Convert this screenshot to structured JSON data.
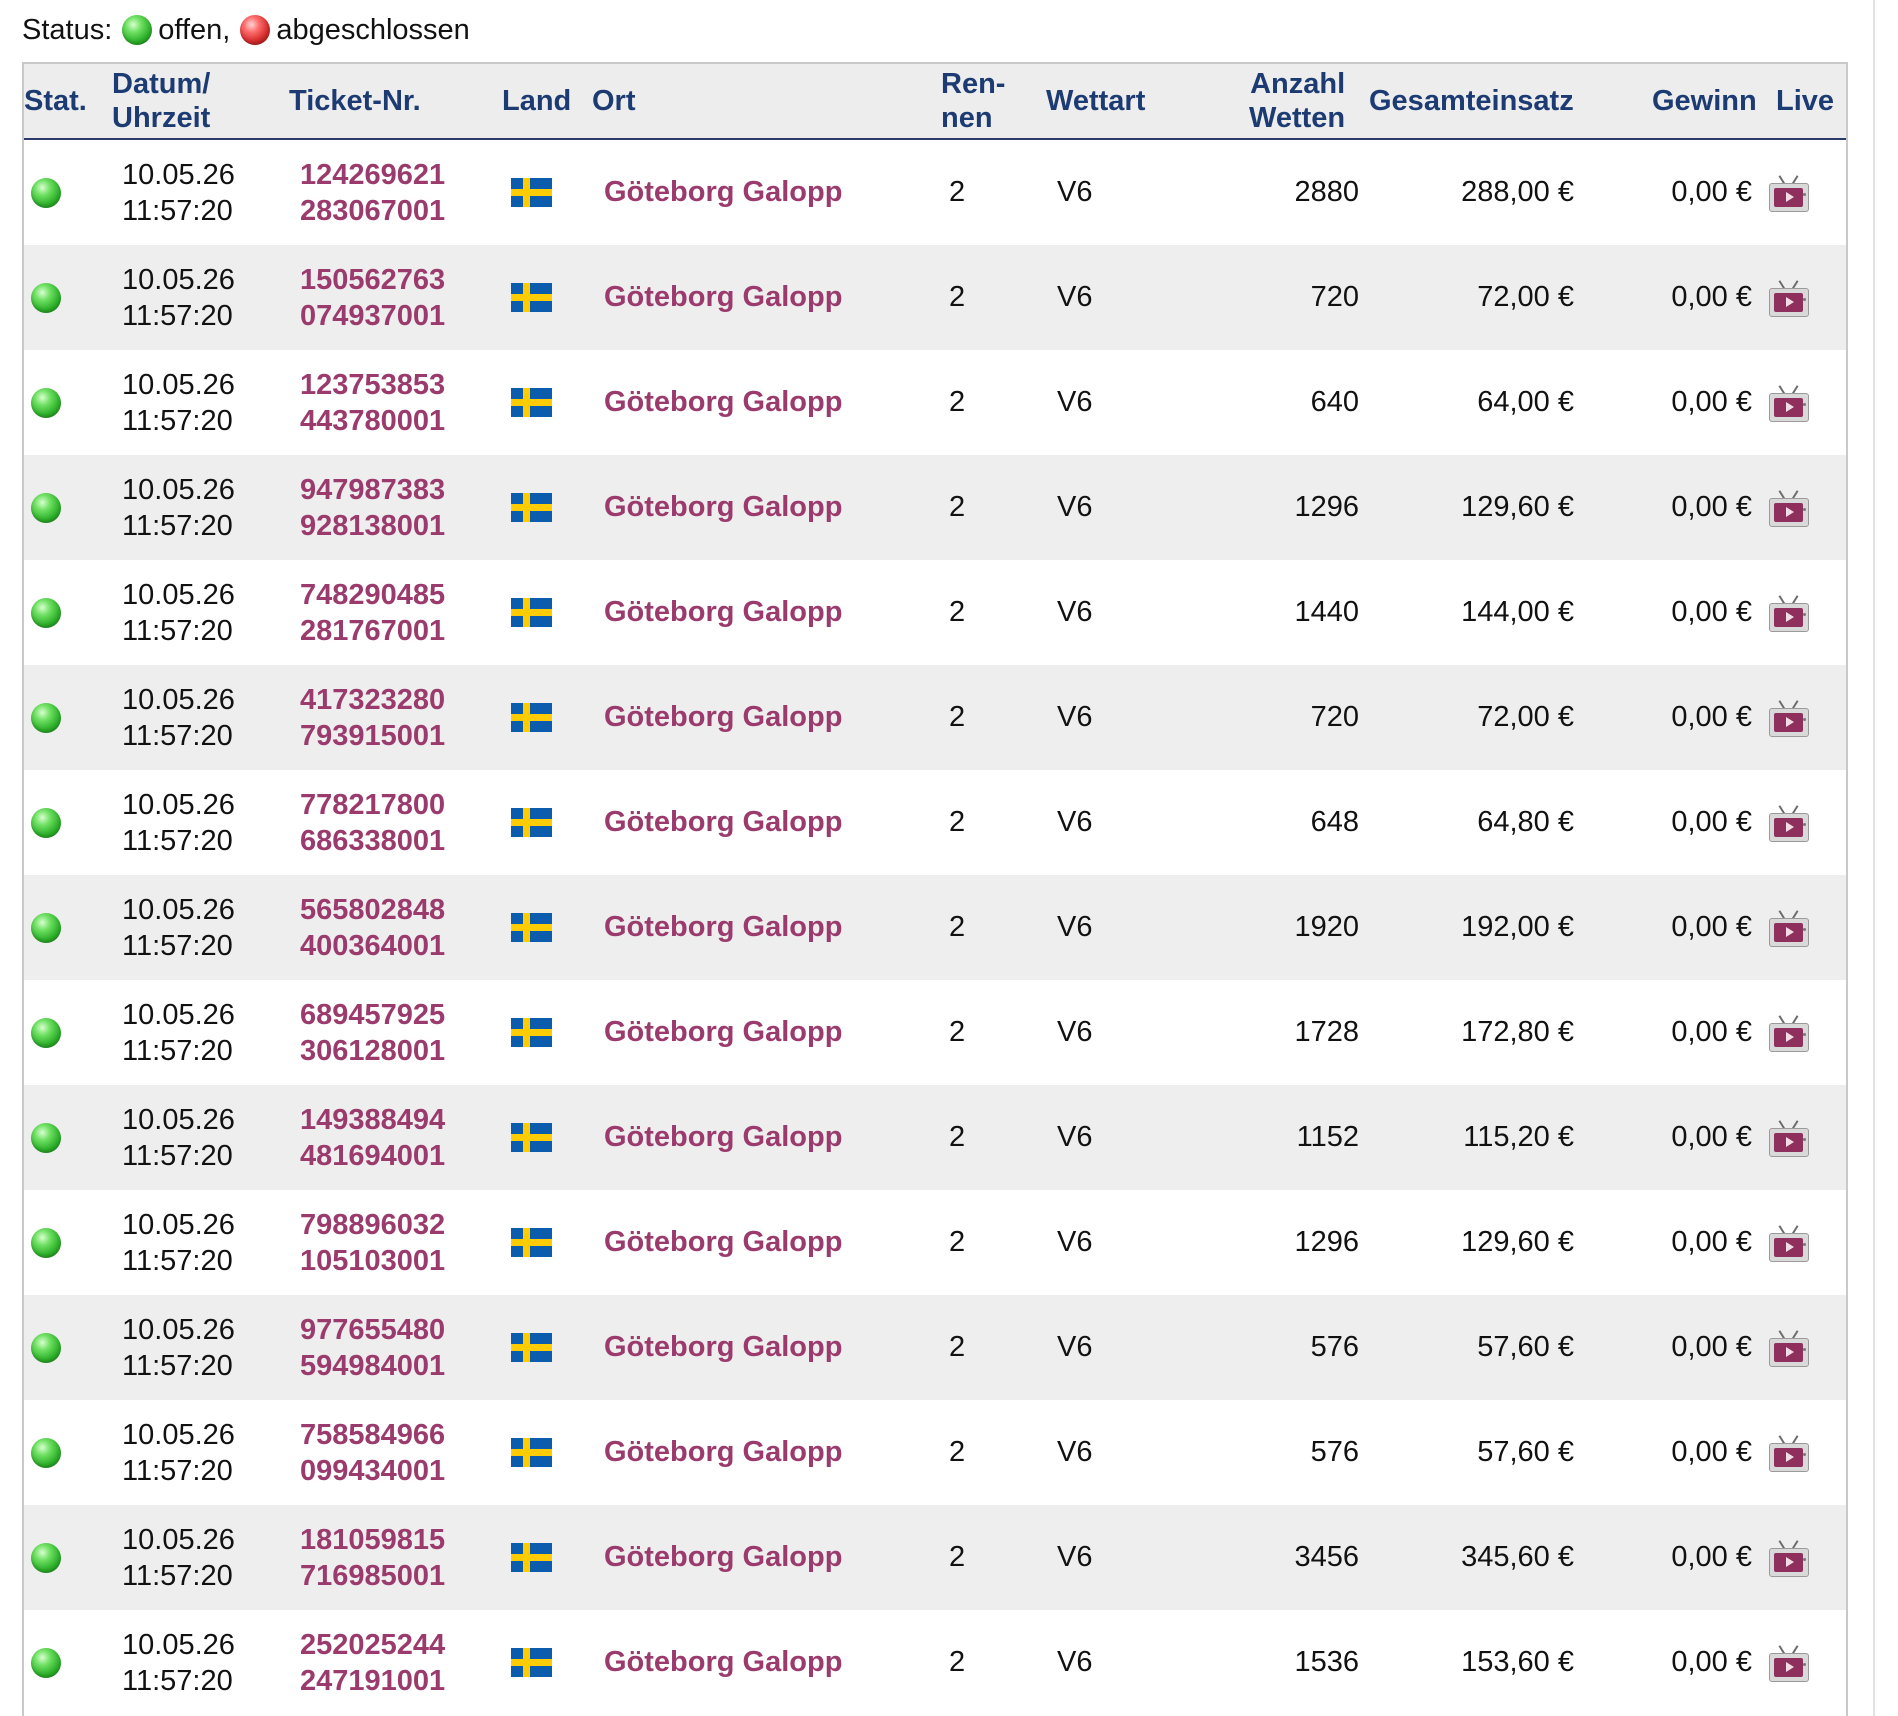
{
  "legend": {
    "label": "Status:",
    "open_label": "offen,",
    "closed_label": "abgeschlossen",
    "open_icon": "green-status-dot",
    "closed_icon": "red-status-dot",
    "open_color": "#2db02a",
    "closed_color": "#d22a2a"
  },
  "table": {
    "headers": {
      "status": "Stat.",
      "datetime_1": "Datum/",
      "datetime_2": "Uhrzeit",
      "ticket": "Ticket-Nr.",
      "country": "Land",
      "place": "Ort",
      "race_1": "Ren-",
      "race_2": "nen",
      "bet_type": "Wettart",
      "count_1": "Anzahl",
      "count_2": "Wetten",
      "stake": "Gesamteinsatz",
      "win": "Gewinn",
      "live": "Live"
    },
    "header_color": "#1d3b73",
    "link_color": "#9b3b6d",
    "row_alt_color": "#eeeeee",
    "rows": [
      {
        "status": "open",
        "date": "10.05.26",
        "time": "11:57:20",
        "ticket_1": "124269621",
        "ticket_2": "283067001",
        "country": "Schweden",
        "place": "Göteborg Galopp",
        "race": "2",
        "bet_type": "V6",
        "bets": "2880",
        "stake": "288,00 €",
        "win": "0,00 €"
      },
      {
        "status": "open",
        "date": "10.05.26",
        "time": "11:57:20",
        "ticket_1": "150562763",
        "ticket_2": "074937001",
        "country": "Schweden",
        "place": "Göteborg Galopp",
        "race": "2",
        "bet_type": "V6",
        "bets": "720",
        "stake": "72,00 €",
        "win": "0,00 €"
      },
      {
        "status": "open",
        "date": "10.05.26",
        "time": "11:57:20",
        "ticket_1": "123753853",
        "ticket_2": "443780001",
        "country": "Schweden",
        "place": "Göteborg Galopp",
        "race": "2",
        "bet_type": "V6",
        "bets": "640",
        "stake": "64,00 €",
        "win": "0,00 €"
      },
      {
        "status": "open",
        "date": "10.05.26",
        "time": "11:57:20",
        "ticket_1": "947987383",
        "ticket_2": "928138001",
        "country": "Schweden",
        "place": "Göteborg Galopp",
        "race": "2",
        "bet_type": "V6",
        "bets": "1296",
        "stake": "129,60 €",
        "win": "0,00 €"
      },
      {
        "status": "open",
        "date": "10.05.26",
        "time": "11:57:20",
        "ticket_1": "748290485",
        "ticket_2": "281767001",
        "country": "Schweden",
        "place": "Göteborg Galopp",
        "race": "2",
        "bet_type": "V6",
        "bets": "1440",
        "stake": "144,00 €",
        "win": "0,00 €"
      },
      {
        "status": "open",
        "date": "10.05.26",
        "time": "11:57:20",
        "ticket_1": "417323280",
        "ticket_2": "793915001",
        "country": "Schweden",
        "place": "Göteborg Galopp",
        "race": "2",
        "bet_type": "V6",
        "bets": "720",
        "stake": "72,00 €",
        "win": "0,00 €"
      },
      {
        "status": "open",
        "date": "10.05.26",
        "time": "11:57:20",
        "ticket_1": "778217800",
        "ticket_2": "686338001",
        "country": "Schweden",
        "place": "Göteborg Galopp",
        "race": "2",
        "bet_type": "V6",
        "bets": "648",
        "stake": "64,80 €",
        "win": "0,00 €"
      },
      {
        "status": "open",
        "date": "10.05.26",
        "time": "11:57:20",
        "ticket_1": "565802848",
        "ticket_2": "400364001",
        "country": "Schweden",
        "place": "Göteborg Galopp",
        "race": "2",
        "bet_type": "V6",
        "bets": "1920",
        "stake": "192,00 €",
        "win": "0,00 €"
      },
      {
        "status": "open",
        "date": "10.05.26",
        "time": "11:57:20",
        "ticket_1": "689457925",
        "ticket_2": "306128001",
        "country": "Schweden",
        "place": "Göteborg Galopp",
        "race": "2",
        "bet_type": "V6",
        "bets": "1728",
        "stake": "172,80 €",
        "win": "0,00 €"
      },
      {
        "status": "open",
        "date": "10.05.26",
        "time": "11:57:20",
        "ticket_1": "149388494",
        "ticket_2": "481694001",
        "country": "Schweden",
        "place": "Göteborg Galopp",
        "race": "2",
        "bet_type": "V6",
        "bets": "1152",
        "stake": "115,20 €",
        "win": "0,00 €"
      },
      {
        "status": "open",
        "date": "10.05.26",
        "time": "11:57:20",
        "ticket_1": "798896032",
        "ticket_2": "105103001",
        "country": "Schweden",
        "place": "Göteborg Galopp",
        "race": "2",
        "bet_type": "V6",
        "bets": "1296",
        "stake": "129,60 €",
        "win": "0,00 €"
      },
      {
        "status": "open",
        "date": "10.05.26",
        "time": "11:57:20",
        "ticket_1": "977655480",
        "ticket_2": "594984001",
        "country": "Schweden",
        "place": "Göteborg Galopp",
        "race": "2",
        "bet_type": "V6",
        "bets": "576",
        "stake": "57,60 €",
        "win": "0,00 €"
      },
      {
        "status": "open",
        "date": "10.05.26",
        "time": "11:57:20",
        "ticket_1": "758584966",
        "ticket_2": "099434001",
        "country": "Schweden",
        "place": "Göteborg Galopp",
        "race": "2",
        "bet_type": "V6",
        "bets": "576",
        "stake": "57,60 €",
        "win": "0,00 €"
      },
      {
        "status": "open",
        "date": "10.05.26",
        "time": "11:57:20",
        "ticket_1": "181059815",
        "ticket_2": "716985001",
        "country": "Schweden",
        "place": "Göteborg Galopp",
        "race": "2",
        "bet_type": "V6",
        "bets": "3456",
        "stake": "345,60 €",
        "win": "0,00 €"
      },
      {
        "status": "open",
        "date": "10.05.26",
        "time": "11:57:20",
        "ticket_1": "252025244",
        "ticket_2": "247191001",
        "country": "Schweden",
        "place": "Göteborg Galopp",
        "race": "2",
        "bet_type": "V6",
        "bets": "1536",
        "stake": "153,60 €",
        "win": "0,00 €"
      }
    ]
  }
}
